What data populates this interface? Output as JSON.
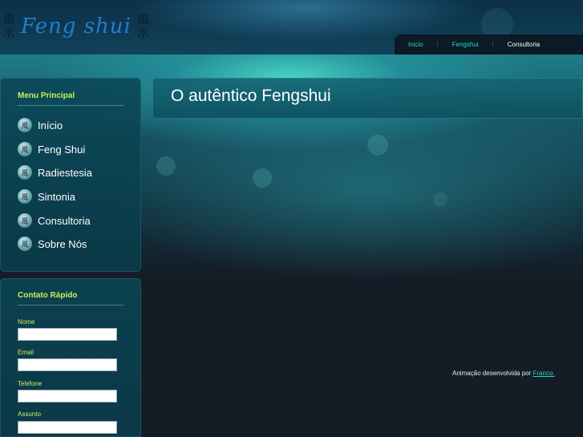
{
  "logo": {
    "text": "Feng shui",
    "kanji_left": "風水",
    "kanji_right": "風水"
  },
  "topnav": [
    "Inicio",
    "Fengshui",
    "Consultoria"
  ],
  "menu": {
    "title": "Menu Principal",
    "items": [
      "Início",
      "Feng Shui",
      "Radiestesia",
      "Sintonia",
      "Consultoria",
      "Sobre Nós"
    ]
  },
  "contact": {
    "title": "Contato Rápido",
    "fields": [
      "Nome",
      "Email",
      "Telefone",
      "Assunto"
    ]
  },
  "main": {
    "title": "O autêntico Fengshui"
  },
  "footer": {
    "credit_text": "Animação desenvolvida por ",
    "credit_link": "Franco."
  },
  "colors": {
    "accent_green": "#c8f05a",
    "link_cyan": "#2bd6d0",
    "logo_blue": "#1e7fd0"
  }
}
